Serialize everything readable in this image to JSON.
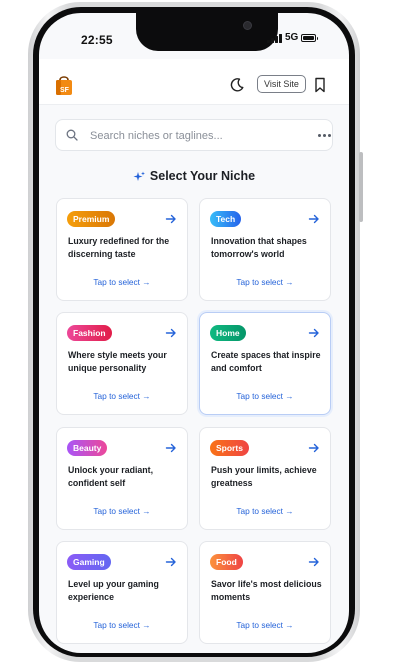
{
  "status": {
    "time": "22:55",
    "network": "5G"
  },
  "header": {
    "logo_text": "SF",
    "visit_label": "Visit Site",
    "icons": {
      "theme": "moon-icon",
      "bookmark": "bookmark-icon"
    }
  },
  "search": {
    "placeholder": "Search niches or taglines...",
    "value": ""
  },
  "section": {
    "title": "Select Your Niche"
  },
  "niches": [
    {
      "badge": "Premium",
      "desc": "Luxury redefined for the discerning taste",
      "tap": "Tap to select →",
      "gradient": [
        "#f59e0b",
        "#d97706"
      ]
    },
    {
      "badge": "Tech",
      "desc": "Innovation that shapes tomorrow's world",
      "tap": "Tap to select →",
      "gradient": [
        "#38bdf8",
        "#2563eb"
      ]
    },
    {
      "badge": "Fashion",
      "desc": "Where style meets your unique personality",
      "tap": "Tap to select →",
      "gradient": [
        "#ec4899",
        "#e11d48"
      ]
    },
    {
      "badge": "Home",
      "desc": "Create spaces that inspire and comfort",
      "tap": "Tap to select →",
      "gradient": [
        "#10b981",
        "#059669"
      ]
    },
    {
      "badge": "Beauty",
      "desc": "Unlock your radiant, confident self",
      "tap": "Tap to select →",
      "gradient": [
        "#a855f7",
        "#ec4899"
      ]
    },
    {
      "badge": "Sports",
      "desc": "Push your limits, achieve greatness",
      "tap": "Tap to select →",
      "gradient": [
        "#f97316",
        "#ef4444"
      ]
    },
    {
      "badge": "Gaming",
      "desc": "Level up your gaming experience",
      "tap": "Tap to select →",
      "gradient": [
        "#8b5cf6",
        "#6366f1"
      ]
    },
    {
      "badge": "Food",
      "desc": "Savor life's most delicious moments",
      "tap": "Tap to select →",
      "gradient": [
        "#fb923c",
        "#ef4444"
      ]
    }
  ],
  "colors": {
    "accent": "#2563d9",
    "selected_border": "#b9cdf5"
  }
}
